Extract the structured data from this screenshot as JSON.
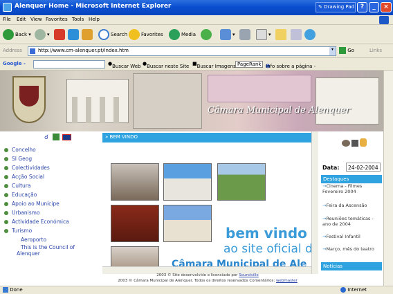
{
  "window": {
    "title": "Alenquer Home - Microsoft Internet Explorer",
    "drawpad": "Drawing Pad"
  },
  "menu": [
    "File",
    "Edit",
    "View",
    "Favorites",
    "Tools",
    "Help"
  ],
  "toolbar": {
    "back": "Back",
    "search": "Search",
    "favorites": "Favorites",
    "media": "Media"
  },
  "address": {
    "label": "Address",
    "url": "http://www.cm-alenquer.pt/index.htm",
    "go": "Go",
    "links": "Links"
  },
  "google": {
    "label": "Google -",
    "buttons": [
      "Buscar Web",
      "Buscar neste Site",
      "Buscar Imagens",
      "PageRank",
      "Info sobre a página -"
    ]
  },
  "banner": {
    "title": "Câmara Municipal de Alenquer"
  },
  "nav": {
    "items": [
      "Concelho",
      "SI Geog",
      "Colectividades",
      "Acção Social",
      "Cultura",
      "Educação",
      "Apoio ao Munícipe",
      "Urbanismo",
      "Actividade Económica",
      "Turismo"
    ],
    "subitems": [
      "Aeroporto",
      "This is the Council of",
      "Alenquer"
    ]
  },
  "content": {
    "heading": "BEM VINDO",
    "line1": "bem vindo",
    "line2": "ao site oficial d",
    "line3": "Câmara Municipal de Ale"
  },
  "side": {
    "date_label": "Data:",
    "date_value": "24-02-2004",
    "destaques": "Destaques",
    "news": [
      "Cinema - Filmes Fevereiro 2004",
      "Feira da Ascensão",
      "Reuniões temáticas - ano de 2004",
      "Festival Infantil",
      "Março, mês do teatro"
    ],
    "noticias": "Notícias"
  },
  "footer": {
    "line1_pre": "2003 © Site desenvolvido e licenciado por ",
    "line1_link": "Soundville",
    "line2_pre": "2003 © Câmara Municipal de Alenquer. Todos os direitos reservados Comentários: ",
    "line2_link": "webmaster"
  },
  "status": {
    "left": "Done",
    "right": "Internet"
  }
}
